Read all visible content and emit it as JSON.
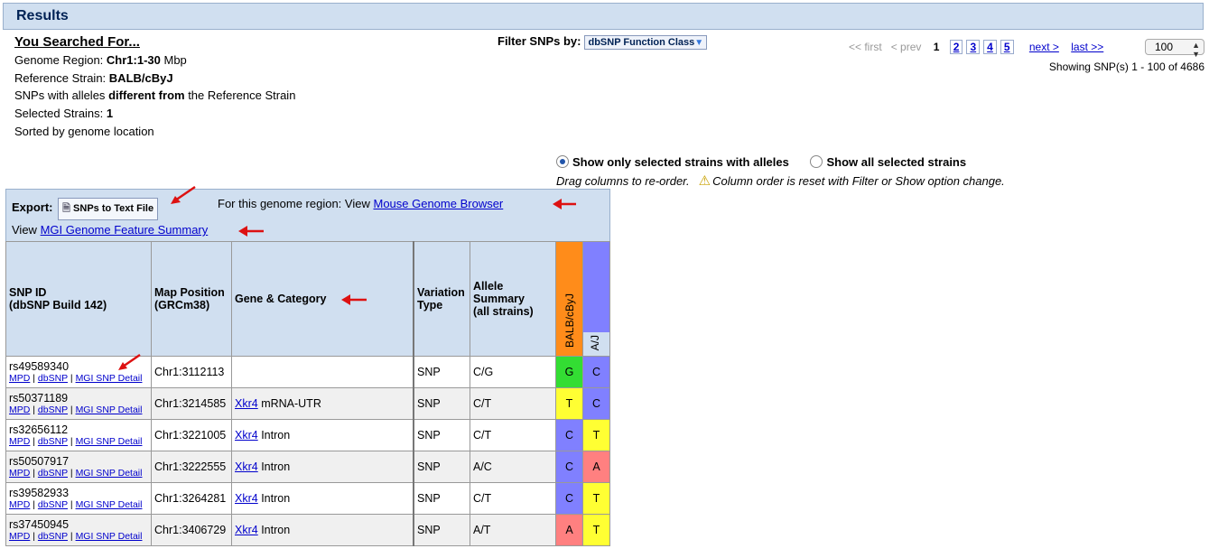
{
  "header": {
    "title": "Results"
  },
  "search": {
    "heading": "You Searched For...",
    "region_label": "Genome Region:",
    "region_value": "Chr1:1-30",
    "region_unit": "Mbp",
    "ref_label": "Reference Strain:",
    "ref_value": "BALB/cByJ",
    "alleles_pre": "SNPs with alleles",
    "alleles_bold": "different from",
    "alleles_post": "the Reference Strain",
    "selected_label": "Selected Strains:",
    "selected_value": "1",
    "sorted": "Sorted by genome location"
  },
  "filter": {
    "label": "Filter SNPs by:",
    "button": "dbSNP Function Class"
  },
  "pager": {
    "first": "<< first",
    "prev": "< prev",
    "current": "1",
    "pages": [
      "2",
      "3",
      "4",
      "5"
    ],
    "next": "next >",
    "last": "last >>",
    "page_size": "100",
    "showing": "Showing SNP(s) 1 - 100 of 4686"
  },
  "options": {
    "show_selected": "Show only selected strains with alleles",
    "show_all": "Show all selected strains",
    "drag_note": "Drag columns to re-order.",
    "reset_note": "Column order is reset with Filter or Show option change."
  },
  "export": {
    "label": "Export:",
    "button": "SNPs to Text File",
    "region_text": "For this genome region:  View",
    "browser_link": "Mouse Genome Browser",
    "view_text": "View",
    "mgi_link": "MGI Genome Feature Summary"
  },
  "table": {
    "headers": {
      "snp_id": "SNP ID",
      "snp_build": "(dbSNP Build 142)",
      "map": "Map Position",
      "map_build": "(GRCm38)",
      "gene": "Gene & Category",
      "variation": "Variation",
      "variation2": "Type",
      "allele": "Allele",
      "allele2": "Summary",
      "allele3": "(all strains)",
      "strain1": "BALB/cByJ",
      "strain2": "A/J"
    },
    "link_labels": {
      "mpd": "MPD",
      "dbsnp": "dbSNP",
      "mgi": "MGI SNP Detail"
    },
    "rows": [
      {
        "id": "rs49589340",
        "pos": "Chr1:3112113",
        "gene": "",
        "cat": "",
        "type": "SNP",
        "summary": "C/G",
        "a1": "G",
        "a2": "C"
      },
      {
        "id": "rs50371189",
        "pos": "Chr1:3214585",
        "gene": "Xkr4",
        "cat": "mRNA-UTR",
        "type": "SNP",
        "summary": "C/T",
        "a1": "T",
        "a2": "C"
      },
      {
        "id": "rs32656112",
        "pos": "Chr1:3221005",
        "gene": "Xkr4",
        "cat": "Intron",
        "type": "SNP",
        "summary": "C/T",
        "a1": "C",
        "a2": "T"
      },
      {
        "id": "rs50507917",
        "pos": "Chr1:3222555",
        "gene": "Xkr4",
        "cat": "Intron",
        "type": "SNP",
        "summary": "A/C",
        "a1": "C",
        "a2": "A"
      },
      {
        "id": "rs39582933",
        "pos": "Chr1:3264281",
        "gene": "Xkr4",
        "cat": "Intron",
        "type": "SNP",
        "summary": "C/T",
        "a1": "C",
        "a2": "T"
      },
      {
        "id": "rs37450945",
        "pos": "Chr1:3406729",
        "gene": "Xkr4",
        "cat": "Intron",
        "type": "SNP",
        "summary": "A/T",
        "a1": "A",
        "a2": "T"
      }
    ]
  },
  "colors": {
    "A": "#ff8080",
    "C": "#8080ff",
    "G": "#33dd33",
    "T": "#ffff33",
    "strain1_head": "#ff8c1a",
    "strain2_head": "#8080ff",
    "arrow": "#dd1111"
  }
}
